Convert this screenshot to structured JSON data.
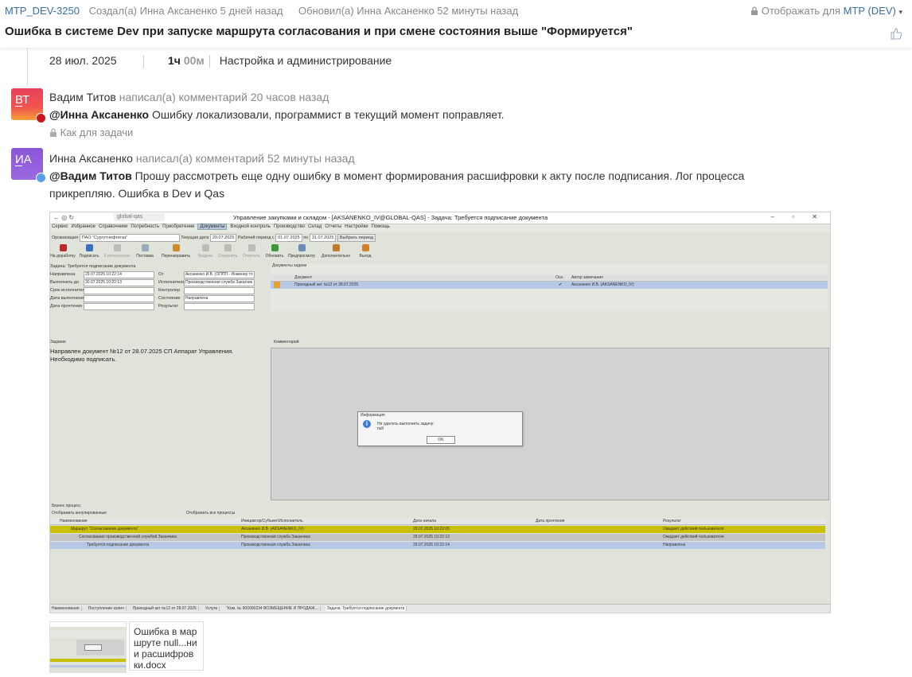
{
  "header": {
    "task_id": "MTP_DEV-3250",
    "created": "Создал(а) Инна Аксаненко 5 дней назад",
    "updated": "Обновил(а) Инна Аксаненко 52 минуты назад",
    "visibility_label": "Отображать для",
    "visibility_value": "MTP (DEV)",
    "title": "Ошибка в системе Dev при запуске маршрута согласования и при смене состояния выше \"Формируется\""
  },
  "worklog": {
    "date": "28 июл. 2025",
    "hours": "1ч",
    "minutes": "00м",
    "activity": "Настройка и администрирование"
  },
  "comments": [
    {
      "initials": "ВТ",
      "author": "Вадим Титов",
      "action": "написал(а) комментарий 20 часов назад",
      "mention": "@Инна Аксаненко",
      "text": "Ошибку локализовали, программист в текущий момент поправляет.",
      "visibility": "Как для задачи",
      "avatar_color": "#e8415e"
    },
    {
      "initials": "ИА",
      "author": "Инна Аксаненко",
      "action": "написал(а) комментарий 52 минуты назад",
      "mention": "@Вадим Титов",
      "text": "Прошу рассмотреть еще одну ошибку в момент формирования расшифровки к акту после подписания. Лог процесса прикрепляю. Ошибка в Dev и Qas",
      "avatar_color": "#8a56d8"
    }
  ],
  "screenshot": {
    "url": "global-qas",
    "window_title": "Управление закупками и складом - [AKSANENKO_IV@GLOBAL-QAS] - Задача: Требуется подписание документа",
    "menu": [
      "Сервис",
      "Избранное",
      "Справочники",
      "Потребность",
      "Приобретение",
      "Документы",
      "Входной контроль",
      "Производство",
      "Склад",
      "Отчеты",
      "Настройки",
      "Помощь"
    ],
    "active_menu": "Документы",
    "org_label": "Организация",
    "org_value": "ПАО \"Сургутнефтегаз\"",
    "cur_date_label": "Текущая дата",
    "cur_date": "29.07.2025",
    "period_label": "Рабочий период с",
    "period_from": "01.07.2025",
    "period_to_label": "по",
    "period_to": "31.07.2025",
    "period_button": "Выбрать период",
    "toolbar": [
      "На доработку",
      "Подписать",
      "К исполнению",
      "Поставка",
      "Перенаправить",
      "Выдача",
      "Сохранить",
      "Отметить",
      "Обновить",
      "Предпросмотр",
      "Дополнительно",
      "Выход"
    ],
    "task_header": "Задача: Требуется подписание документа",
    "form": [
      {
        "label": "Направлена",
        "value": "29.07.2025 10:22:14",
        "label2": "От",
        "value2": "Аксаненко И.В. (ОППП - Инженер то"
      },
      {
        "label": "Выполнить до",
        "value": "30.07.2025 10:22:13",
        "label2": "Исполнитель",
        "value2": "Производственная служба Заказчик"
      },
      {
        "label": "Срок исполнителя",
        "value": "",
        "label2": "Контролер",
        "value2": ""
      },
      {
        "label": "Дата выполнения",
        "value": "",
        "label2": "Состояние",
        "value2": "Направлена"
      },
      {
        "label": "Дата прочтения",
        "value": "",
        "label2": "Результат",
        "value2": ""
      }
    ],
    "docs_title": "Документы задачи",
    "docs_columns": [
      "Документ",
      "Осн.",
      "Автор замечания"
    ],
    "docs_row": [
      "Приходный акт №12 от 28.07.2025",
      "✔",
      "Аксаненко И.В. (AKSANENKO_IV)"
    ],
    "task_label": "Задание",
    "task_text": "Направлен документ №12 от 28.07.2025 СП Аппарат Управления. Необходимо подписать.",
    "comment_label": "Комментарий",
    "dialog_title": "Информация",
    "dialog_message": "Не удалось выполнить задачу:",
    "dialog_detail": "null",
    "dialog_ok": "OK",
    "bp_label": "Бизнес процесс",
    "bp_show_cancelled": "Отображать аннулированные",
    "bp_show_all": "Отображать все процессы",
    "bp_columns": [
      "Наименование",
      "Инициатор/Субъект/Исполнитель",
      "Дата начала",
      "Дата прочтения",
      "Результат"
    ],
    "bp_rows": [
      [
        "Маршрут \"Согласование документа\"",
        "Аксаненко И.В. (AKSANENKO_IV)",
        "29.07.2025 10:22:06",
        "",
        "Ожидает действий пользователя"
      ],
      [
        "Согласование производственной службой Заказчика",
        "Производственная служба Заказчика",
        "29.07.2025 10:22:13",
        "",
        "Ожидает действий пользователя"
      ],
      [
        "Требуется подписание документа",
        "Производственная служба Заказчика",
        "29.07.2025 10:22:14",
        "",
        "Направлена"
      ]
    ],
    "tabs": [
      "Наименования",
      "Поступление колич",
      "Приходный акт №12 от 28.07.2025",
      "Услуги",
      "\"Ком. № 900000234 ВОЗМЕЩЕНИЕ И ПРОДАЖ...",
      "Задача: Требуется подписание документа"
    ]
  },
  "attachment": {
    "filename": "Ошибка в мар\nшруте null...ни\nи расшифров\nки.docx"
  }
}
